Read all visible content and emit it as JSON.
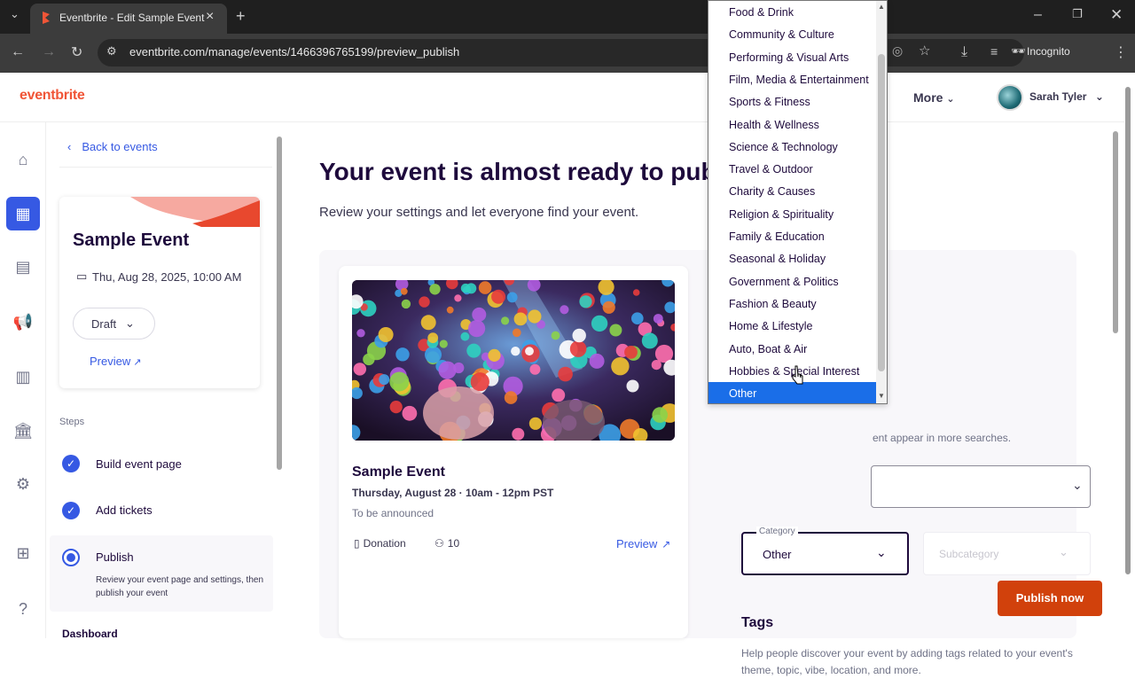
{
  "browser": {
    "tab_title": "Eventbrite - Edit Sample Event",
    "url": "eventbrite.com/manage/events/1466396765199/preview_publish",
    "incognito_label": "Incognito"
  },
  "header": {
    "logo": "eventbrite",
    "more_label": "More",
    "user_name": "Sarah Tyler"
  },
  "sidebar": {
    "back_label": "Back to events",
    "event_title": "Sample Event",
    "event_date": "Thu, Aug 28, 2025, 10:00 AM",
    "status": "Draft",
    "preview_label": "Preview",
    "steps_heading": "Steps",
    "steps": [
      {
        "label": "Build event page"
      },
      {
        "label": "Add tickets"
      },
      {
        "label": "Publish",
        "description": "Review your event page and settings, then publish your event"
      }
    ],
    "dashboard_label": "Dashboard"
  },
  "main": {
    "title": "Your event is almost ready to publish",
    "subtitle": "Review your settings and let everyone find your event.",
    "card": {
      "name": "Sample Event",
      "datetime": "Thursday, August 28 · 10am - 12pm PST",
      "location": "To be announced",
      "price": "Donation",
      "capacity": "10",
      "preview_label": "Preview"
    },
    "help_text_partial": "ent appear in more searches.",
    "category": {
      "label": "Category",
      "value": "Other",
      "options": [
        "Food & Drink",
        "Community & Culture",
        "Performing & Visual Arts",
        "Film, Media & Entertainment",
        "Sports & Fitness",
        "Health & Wellness",
        "Science & Technology",
        "Travel & Outdoor",
        "Charity & Causes",
        "Religion & Spirituality",
        "Family & Education",
        "Seasonal & Holiday",
        "Government & Politics",
        "Fashion & Beauty",
        "Home & Lifestyle",
        "Auto, Boat & Air",
        "Hobbies & Special Interest",
        "Other"
      ],
      "selected_index": 17
    },
    "subcategory_placeholder": "Subcategory",
    "tags_heading": "Tags",
    "tags_description": "Help people discover your event by adding tags related to your event's theme, topic, vibe, location, and more.",
    "publish_button": "Publish now"
  },
  "colors": {
    "brand": "#f05537",
    "primary_blue": "#3659e3",
    "publish": "#d1410c",
    "selected_option": "#1a6ee8"
  }
}
